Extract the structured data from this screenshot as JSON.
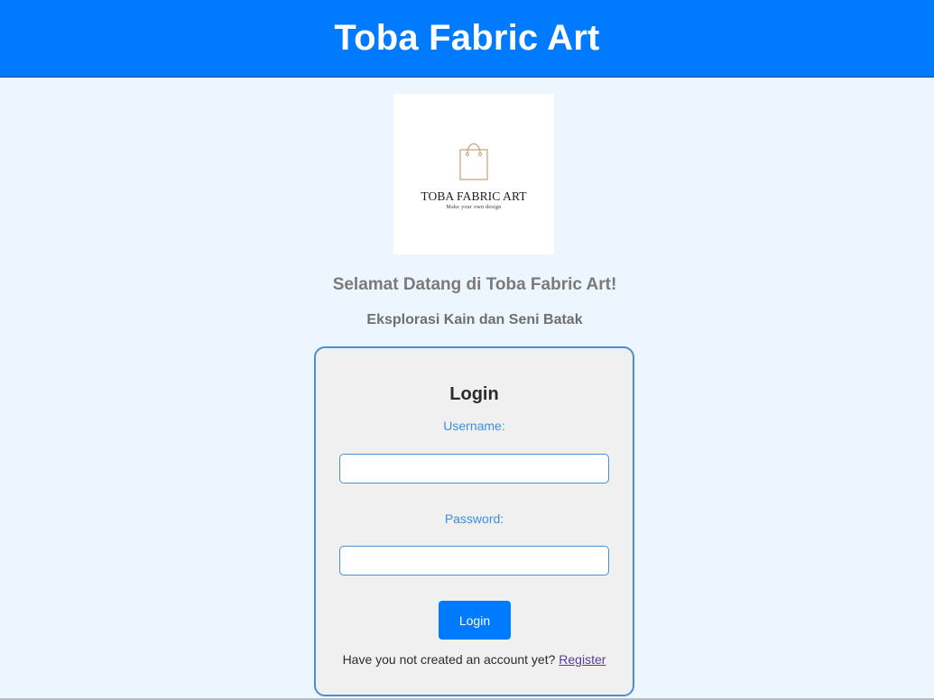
{
  "header": {
    "title": "Toba Fabric Art"
  },
  "logo": {
    "icon": "shopping-bag-icon",
    "brand": "TOBA FABRIC ART",
    "tagline": "Make your own design"
  },
  "intro": {
    "welcome": "Selamat Datang di Toba Fabric Art!",
    "subtitle": "Eksplorasi Kain dan Seni Batak"
  },
  "login_form": {
    "title": "Login",
    "username_label": "Username:",
    "username_value": "",
    "password_label": "Password:",
    "password_value": "",
    "submit_label": "Login",
    "register_prompt": "Have you not created an account yet?",
    "register_link": "Register"
  },
  "colors": {
    "header_bg": "#007bff",
    "page_bg": "#edf6fe",
    "card_bg": "#f0f0f0",
    "accent_blue": "#3a8ee6",
    "logo_bag": "#c8a27a"
  }
}
